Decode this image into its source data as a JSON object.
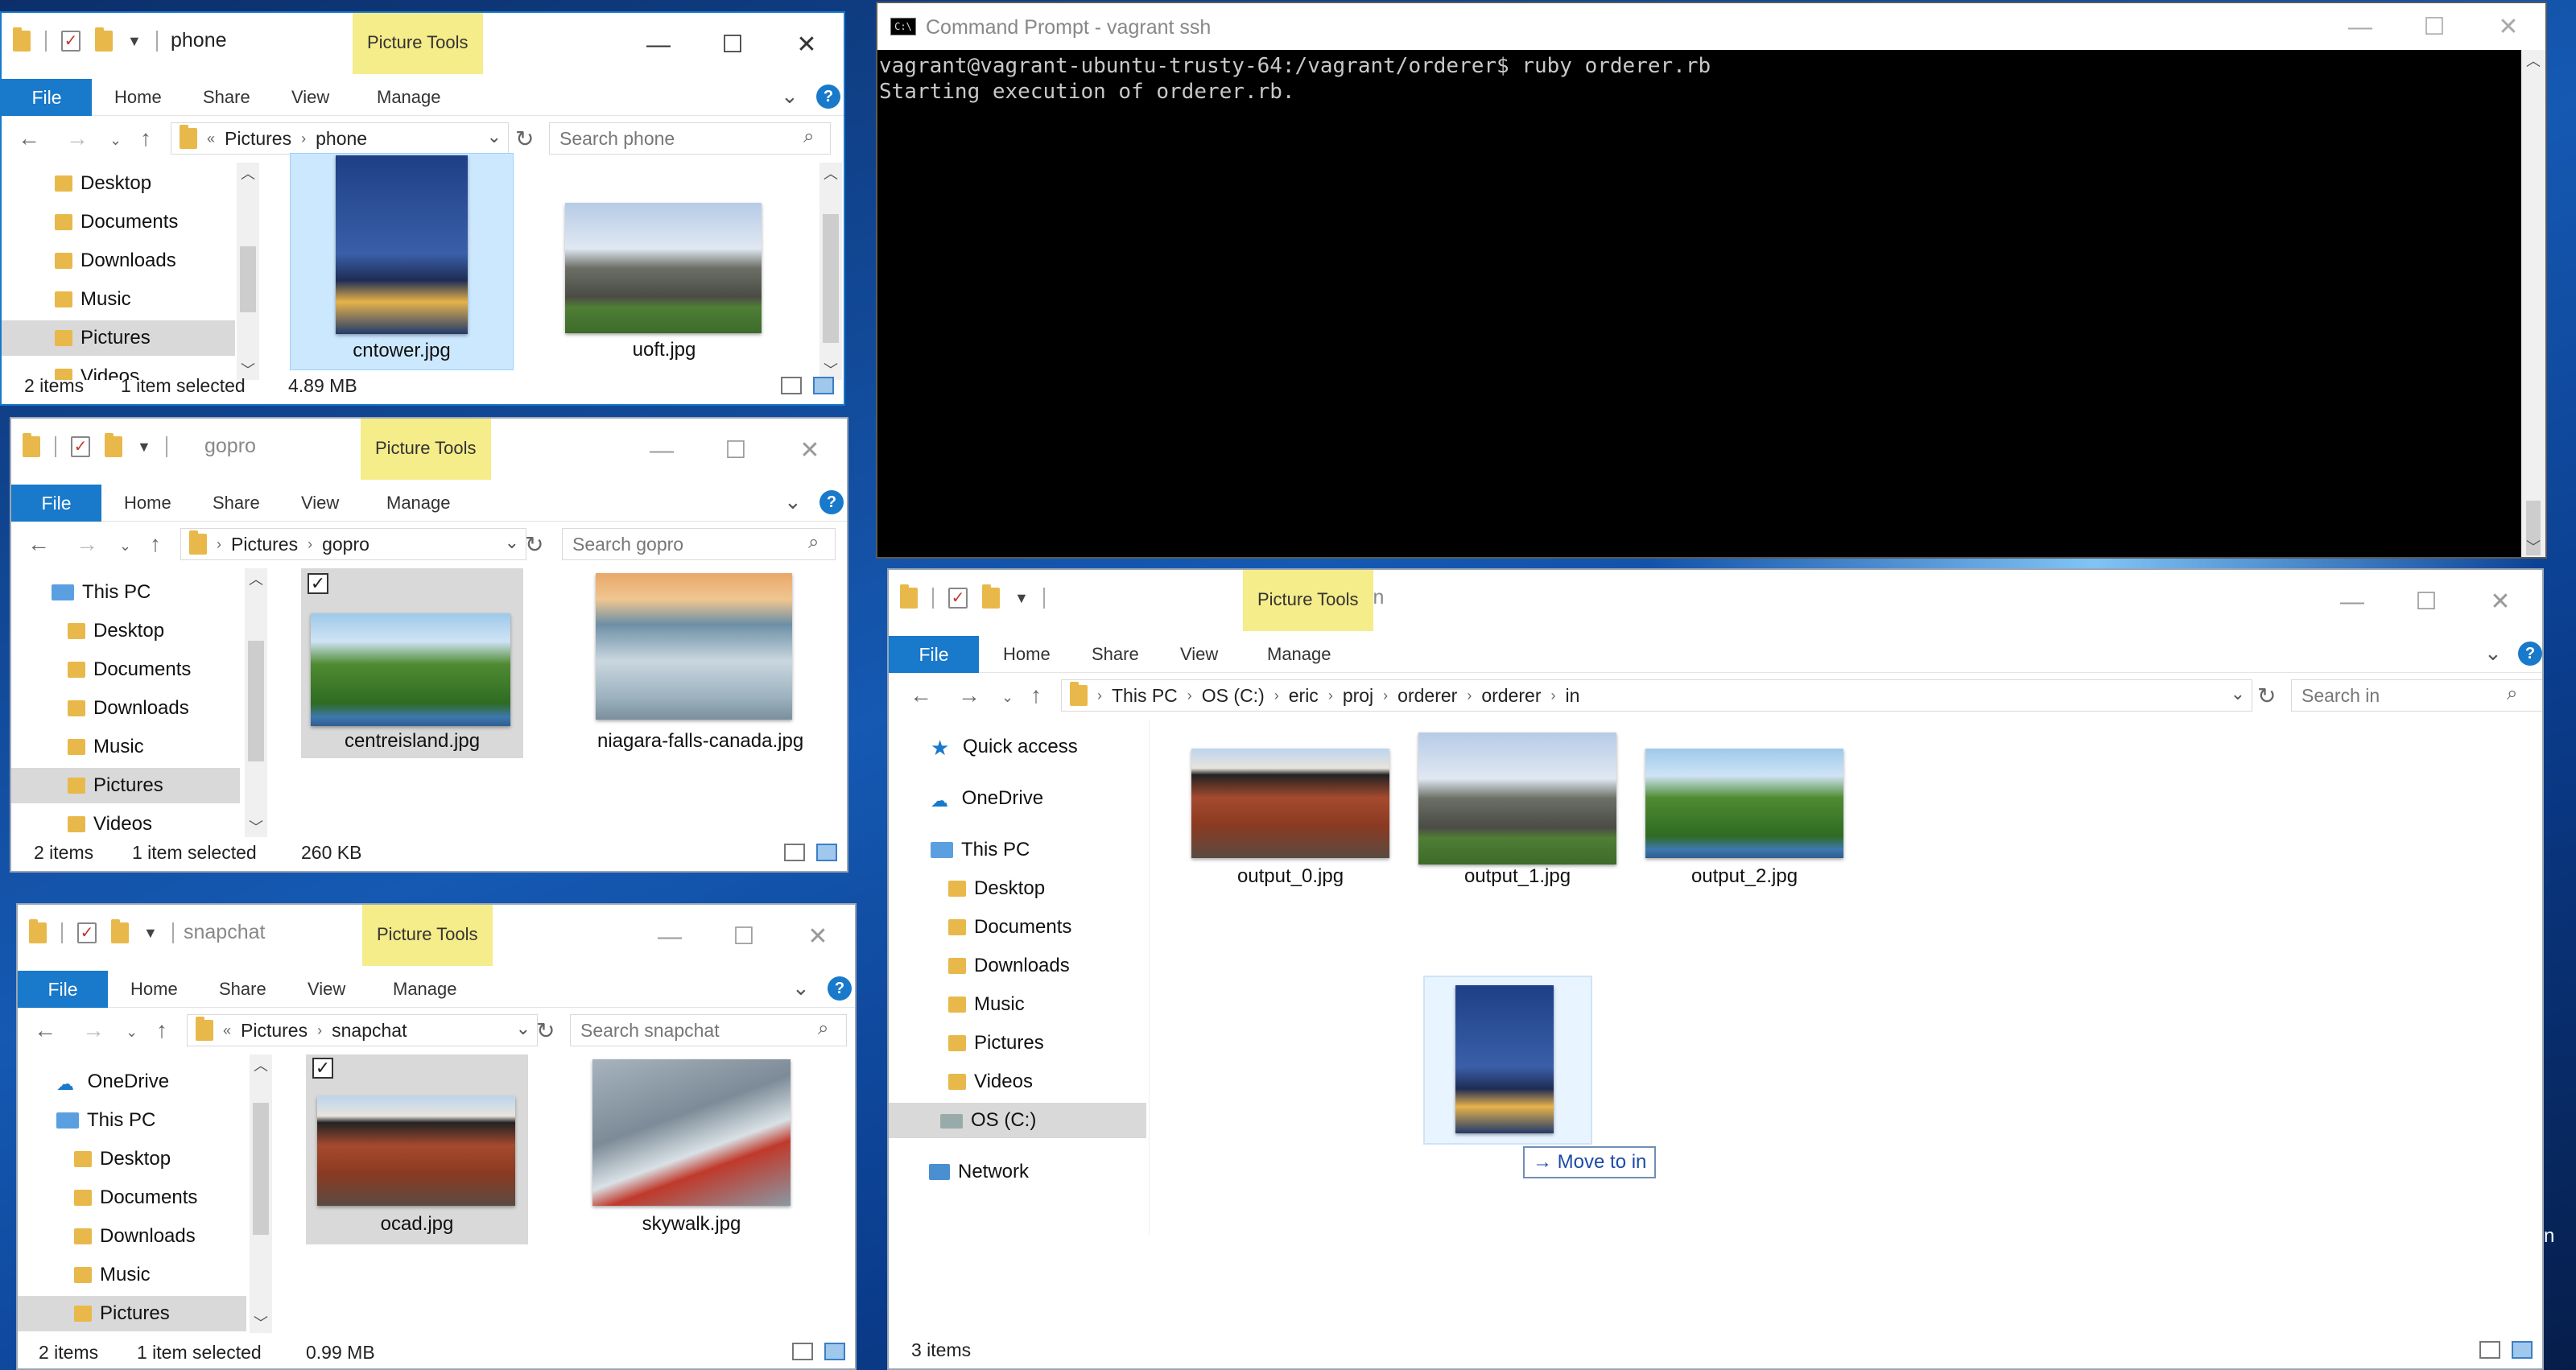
{
  "windows": {
    "phone": {
      "title": "phone",
      "picture_tools": "Picture Tools",
      "tabs": {
        "file": "File",
        "home": "Home",
        "share": "Share",
        "view": "View",
        "manage": "Manage"
      },
      "path": [
        "Pictures",
        "phone"
      ],
      "search_placeholder": "Search phone",
      "tree": [
        "Desktop",
        "Documents",
        "Downloads",
        "Music",
        "Pictures",
        "Videos"
      ],
      "files": [
        {
          "name": "cntower.jpg",
          "selected": true
        },
        {
          "name": "uoft.jpg",
          "selected": false
        }
      ],
      "status": {
        "count": "2 items",
        "selected": "1 item selected",
        "size": "4.89 MB"
      }
    },
    "gopro": {
      "title": "gopro",
      "picture_tools": "Picture Tools",
      "tabs": {
        "file": "File",
        "home": "Home",
        "share": "Share",
        "view": "View",
        "manage": "Manage"
      },
      "path": [
        "Pictures",
        "gopro"
      ],
      "search_placeholder": "Search gopro",
      "tree": [
        "This PC",
        "Desktop",
        "Documents",
        "Downloads",
        "Music",
        "Pictures",
        "Videos"
      ],
      "files": [
        {
          "name": "centreisland.jpg",
          "selected": true
        },
        {
          "name": "niagara-falls-canada.jpg",
          "selected": false
        }
      ],
      "status": {
        "count": "2 items",
        "selected": "1 item selected",
        "size": "260 KB"
      }
    },
    "snapchat": {
      "title": "snapchat",
      "picture_tools": "Picture Tools",
      "tabs": {
        "file": "File",
        "home": "Home",
        "share": "Share",
        "view": "View",
        "manage": "Manage"
      },
      "path": [
        "Pictures",
        "snapchat"
      ],
      "search_placeholder": "Search snapchat",
      "tree": [
        "OneDrive",
        "This PC",
        "Desktop",
        "Documents",
        "Downloads",
        "Music",
        "Pictures"
      ],
      "files": [
        {
          "name": "ocad.jpg",
          "selected": true
        },
        {
          "name": "skywalk.jpg",
          "selected": false
        }
      ],
      "status": {
        "count": "2 items",
        "selected": "1 item selected",
        "size": "0.99 MB"
      }
    },
    "in": {
      "title": "in",
      "picture_tools": "Picture Tools",
      "tabs": {
        "file": "File",
        "home": "Home",
        "share": "Share",
        "view": "View",
        "manage": "Manage"
      },
      "path": [
        "This PC",
        "OS (C:)",
        "eric",
        "proj",
        "orderer",
        "orderer",
        "in"
      ],
      "search_placeholder": "Search in",
      "tree": [
        "Quick access",
        "OneDrive",
        "This PC",
        "Desktop",
        "Documents",
        "Downloads",
        "Music",
        "Pictures",
        "Videos",
        "OS (C:)",
        "Network"
      ],
      "files": [
        {
          "name": "output_0.jpg"
        },
        {
          "name": "output_1.jpg"
        },
        {
          "name": "output_2.jpg"
        }
      ],
      "status": {
        "count": "3 items"
      }
    }
  },
  "terminal": {
    "title": "Command Prompt - vagrant  ssh",
    "lines": [
      "vagrant@vagrant-ubuntu-trusty-64:/vagrant/orderer$ ruby orderer.rb",
      "Starting execution of orderer.rb."
    ]
  },
  "drag": {
    "tooltip": "Move to in"
  },
  "edge_char": "n",
  "icons": {
    "back": "back-arrow-icon",
    "forward": "forward-arrow-icon",
    "up": "up-arrow-icon",
    "refresh": "refresh-icon",
    "search": "search-icon",
    "help": "help-icon"
  }
}
